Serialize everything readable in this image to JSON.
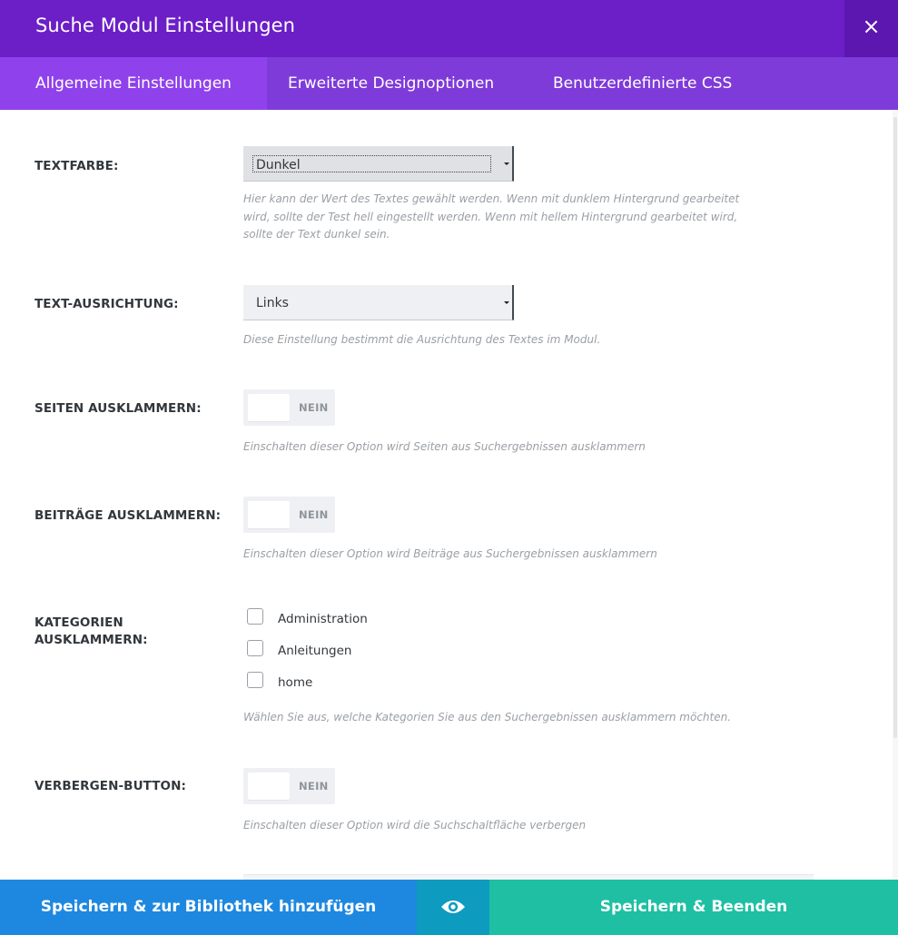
{
  "header": {
    "title": "Suche Modul Einstellungen",
    "close_icon": "close-icon",
    "close_symbol": "×"
  },
  "tabs": [
    {
      "label": "Allgemeine Einstellungen",
      "active": true
    },
    {
      "label": "Erweiterte Designoptionen",
      "active": false
    },
    {
      "label": "Benutzerdefinierte CSS",
      "active": false
    }
  ],
  "fields": {
    "textfarbe": {
      "label": "TEXTFARBE:",
      "value": "Dunkel",
      "desc": "Hier kann der Wert des Textes gewählt werden. Wenn mit dunklem Hintergrund gearbeitet wird, sollte der Test hell eingestellt werden. Wenn mit hellem Hintergrund gearbeitet wird, sollte der Text dunkel sein."
    },
    "ausrichtung": {
      "label": "TEXT-AUSRICHTUNG:",
      "value": "Links",
      "desc": "Diese Einstellung bestimmt die Ausrichtung des Textes im Modul."
    },
    "seiten": {
      "label": "SEITEN AUSKLAMMERN:",
      "toggle": "NEIN",
      "desc": "Einschalten dieser Option wird Seiten aus Suchergebnissen ausklammern"
    },
    "beitraege": {
      "label": "BEITRÄGE AUSKLAMMERN:",
      "toggle": "NEIN",
      "desc": "Einschalten dieser Option wird Beiträge aus Suchergebnissen ausklammern"
    },
    "kategorien": {
      "label_line1": "KATEGORIEN",
      "label_line2": "AUSKLAMMERN:",
      "options": [
        {
          "label": "Administration",
          "checked": false
        },
        {
          "label": "Anleitungen",
          "checked": false
        },
        {
          "label": "home",
          "checked": false
        }
      ],
      "desc": "Wählen Sie aus, welche Kategorien Sie aus den Suchergebnissen ausklammern möchten."
    },
    "verbergen": {
      "label": "VERBERGEN-BUTTON:",
      "toggle": "NEIN",
      "desc": "Einschalten dieser Option wird die Suchschaltfläche verbergen"
    }
  },
  "footer": {
    "library_label": "Speichern & zur Bibliothek hinzufügen",
    "preview_icon": "eye-icon",
    "save_label": "Speichern & Beenden"
  },
  "colors": {
    "header": "#6c1ec7",
    "tabs": "#7e3bd9",
    "active_tab": "#8f42ec",
    "library_button": "#1e88e0",
    "preview_button": "#0d9bc0",
    "save_button": "#1fbfa3"
  }
}
